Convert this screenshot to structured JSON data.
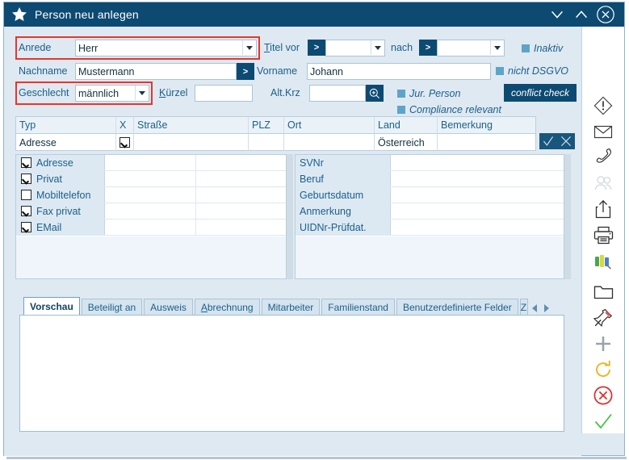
{
  "window": {
    "title": "Person neu anlegen",
    "icon": "star-icon",
    "controls": {
      "minimize": "minimize-icon",
      "maximize": "maximize-icon",
      "close": "close-icon"
    },
    "accent_color": "#0d4a72",
    "highlight_color": "#e8352a",
    "body_color": "#dfe9f2"
  },
  "form": {
    "anrede": {
      "label": "Anrede",
      "value": "Herr",
      "highlighted": true
    },
    "titel_vor": {
      "label": "Titel vor",
      "button": ">",
      "value": ""
    },
    "nach": {
      "label": "nach",
      "button": ">",
      "value": ""
    },
    "inaktiv": {
      "label": "Inaktiv",
      "checked": false
    },
    "nachname": {
      "label": "Nachname",
      "value": "Mustermann",
      "button": ">"
    },
    "vorname": {
      "label": "Vorname",
      "value": "Johann"
    },
    "nicht_dsgvo": {
      "label": "nicht DSGVO",
      "checked": false
    },
    "geschlecht": {
      "label": "Geschlecht",
      "value": "männlich",
      "highlighted": true
    },
    "kuerzel": {
      "label": "Kürzel",
      "value": ""
    },
    "alt_krz": {
      "label": "Alt.Krz",
      "value": "",
      "button_icon": "magnifier-icon"
    },
    "jur_person": {
      "label": "Jur. Person",
      "checked": false
    },
    "compliance_relevant": {
      "label": "Compliance relevant",
      "checked": false
    },
    "conflict_check": {
      "label": "conflict check"
    }
  },
  "address_grid": {
    "columns": [
      "Typ",
      "X",
      "Straße",
      "PLZ",
      "Ort",
      "Land",
      "Bemerkung"
    ],
    "rows": [
      {
        "typ": "Adresse",
        "x_checked": true,
        "strasse": "",
        "plz": "",
        "ort": "",
        "land": "Österreich",
        "bemerkung": ""
      }
    ],
    "row_actions": {
      "accept": "check-icon",
      "cancel": "x-icon"
    }
  },
  "contacts": {
    "items": [
      {
        "label": "Adresse",
        "checked": true,
        "value1": "",
        "value2": ""
      },
      {
        "label": "Privat",
        "checked": true,
        "value1": "",
        "value2": ""
      },
      {
        "label": "Mobiltelefon",
        "checked": false,
        "value1": "",
        "value2": ""
      },
      {
        "label": "Fax privat",
        "checked": true,
        "value1": "",
        "value2": ""
      },
      {
        "label": "EMail",
        "checked": true,
        "value1": "",
        "value2": ""
      }
    ]
  },
  "details": {
    "items": [
      {
        "label": "SVNr",
        "value": ""
      },
      {
        "label": "Beruf",
        "value": ""
      },
      {
        "label": "Geburtsdatum",
        "value": ""
      },
      {
        "label": "Anmerkung",
        "value": ""
      },
      {
        "label": "UIDNr-Prüfdat.",
        "value": ""
      }
    ]
  },
  "tabs": {
    "items": [
      {
        "label": "Vorschau",
        "active": true
      },
      {
        "label": "Beteiligt an",
        "active": false
      },
      {
        "label": "Ausweis",
        "active": false
      },
      {
        "label": "Abrechnung",
        "active": false
      },
      {
        "label": "Mitarbeiter",
        "active": false
      },
      {
        "label": "Familienstand",
        "active": false
      },
      {
        "label": "Benutzerdefinierte Felder",
        "active": false
      }
    ],
    "clipped_label": "Z",
    "nav_prev": "chevron-left-icon",
    "nav_next": "chevron-right-icon"
  },
  "preview": {
    "content": ""
  },
  "toolbar": {
    "items": [
      {
        "name": "info-warning-icon",
        "title": "Hinweis"
      },
      {
        "name": "mail-icon",
        "title": "E-Mail"
      },
      {
        "name": "phone-icon",
        "title": "Telefon"
      },
      {
        "name": "users-icon",
        "title": "Personen"
      },
      {
        "name": "share-export-icon",
        "title": "Export"
      },
      {
        "name": "printer-icon",
        "title": "Drucken"
      },
      {
        "name": "colors-icon",
        "title": "Farben"
      },
      {
        "name": "folder-icon",
        "title": "Ordner"
      },
      {
        "name": "pin-icon",
        "title": "Anheften"
      },
      {
        "name": "plus-icon",
        "title": "Neu"
      },
      {
        "name": "refresh-icon",
        "title": "Aktualisieren"
      },
      {
        "name": "cancel-icon",
        "title": "Abbrechen"
      },
      {
        "name": "confirm-icon",
        "title": "Speichern"
      }
    ]
  }
}
